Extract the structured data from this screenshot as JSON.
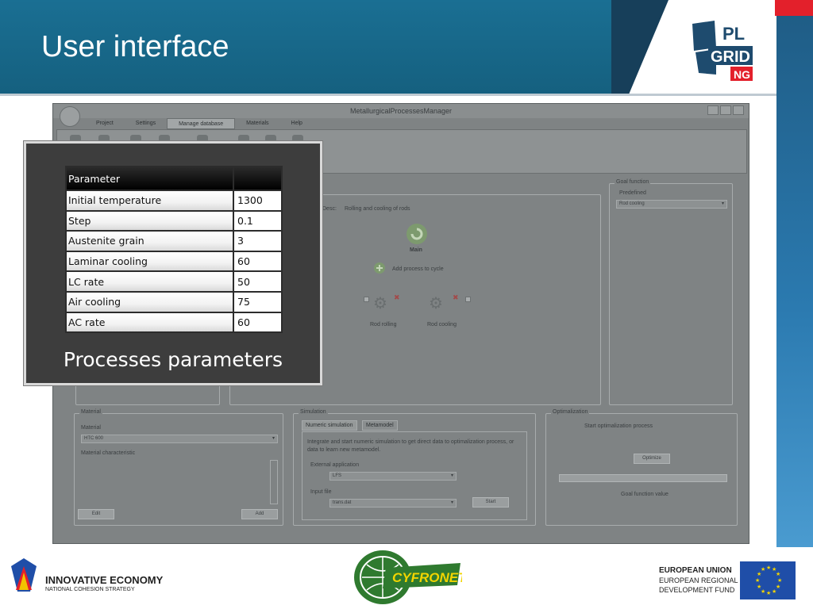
{
  "slide": {
    "title": "User interface",
    "logo_text_top": "PL",
    "logo_text_mid": "GRID",
    "logo_text_bottom": "NG"
  },
  "app": {
    "window_title": "MetallurgicalProcessesManager",
    "menu": [
      "Project",
      "Settings",
      "Manage database",
      "Materials",
      "Help"
    ],
    "active_menu": "Manage database",
    "process_desc_label": "Desc:",
    "process_desc_value": "Rolling and cooling of rods",
    "main_node": "Main",
    "add_process": "Add process to cycle",
    "process_nodes": [
      "Rod rolling",
      "Rod cooling"
    ],
    "goal_function": {
      "legend": "Goal function",
      "predefined_label": "Predefined",
      "predefined_value": "Rod cooling"
    },
    "material": {
      "legend": "Material",
      "material_label": "Material",
      "material_value": "HTC 600",
      "characteristic_label": "Material characteristic",
      "edit_button": "Edit",
      "add_button": "Add"
    },
    "simulation": {
      "legend": "Simulation",
      "tabs": [
        "Numeric simulation",
        "Metamodel"
      ],
      "description": "Integrate and start numeric simulation to get direct data to optimalization process, or data to learn new metamodel.",
      "external_app_label": "External application",
      "external_app_value": "LFS",
      "input_file_label": "Input file",
      "input_file_value": "trans.dat",
      "start_button": "Start"
    },
    "optimization": {
      "legend": "Optimalization",
      "start_label": "Start optimalization process",
      "optimize_button": "Optimize",
      "goal_value_label": "Goal function value"
    }
  },
  "params_panel": {
    "header": "Parameter",
    "header_value": "",
    "rows": [
      {
        "name": "Initial temperature",
        "value": "1300"
      },
      {
        "name": "Step",
        "value": "0.1"
      },
      {
        "name": "Austenite grain",
        "value": "3"
      },
      {
        "name": "Laminar cooling",
        "value": "60"
      },
      {
        "name": "LC rate",
        "value": "50"
      },
      {
        "name": "Air cooling",
        "value": "75"
      },
      {
        "name": "AC rate",
        "value": "60"
      }
    ],
    "caption": "Processes parameters"
  },
  "footer": {
    "innovative_title": "INNOVATIVE ECONOMY",
    "innovative_sub": "NATIONAL COHESION STRATEGY",
    "cyfronet": "CYFRONET",
    "eu_line1": "EUROPEAN UNION",
    "eu_line2": "EUROPEAN REGIONAL",
    "eu_line3": "DEVELOPMENT FUND"
  },
  "colors": {
    "header_blue": "#1a6f93",
    "accent_red": "#e3202b",
    "overlay_bg": "#3d3d3d",
    "eu_blue": "#1f4ea8"
  }
}
